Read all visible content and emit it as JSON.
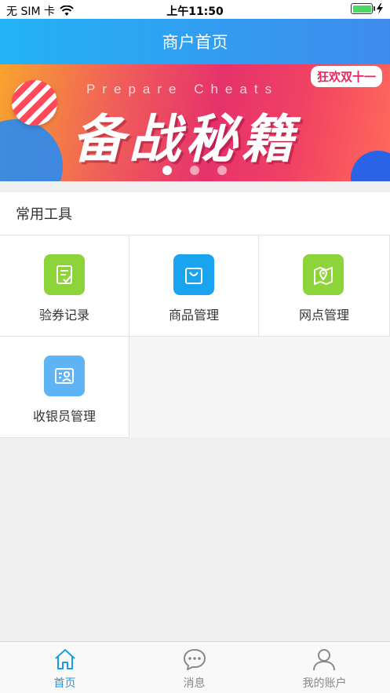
{
  "status_bar": {
    "carrier": "无 SIM 卡",
    "time": "上午11:50",
    "battery_level": 1.0
  },
  "nav": {
    "title": "商户首页"
  },
  "banner": {
    "subtitle": "Prepare Cheats",
    "title": "备战秘籍",
    "tag": "狂欢双十一",
    "dot_count": 3,
    "active_dot": 0
  },
  "tools": {
    "section_title": "常用工具",
    "items": [
      {
        "label": "验券记录",
        "icon": "coupon-record-icon",
        "color": "#8dd43a"
      },
      {
        "label": "商品管理",
        "icon": "shopping-bag-icon",
        "color": "#1aa4ef"
      },
      {
        "label": "网点管理",
        "icon": "map-location-icon",
        "color": "#8dd43a"
      },
      {
        "label": "收银员管理",
        "icon": "cashier-icon",
        "color": "#5fb4f5"
      }
    ]
  },
  "tab_bar": {
    "tabs": [
      {
        "label": "首页",
        "icon": "home-icon",
        "active": true
      },
      {
        "label": "消息",
        "icon": "message-icon",
        "active": false
      },
      {
        "label": "我的账户",
        "icon": "user-icon",
        "active": false
      }
    ]
  },
  "colors": {
    "accent": "#1a9be8",
    "nav_start": "#23b3f6",
    "nav_end": "#3f8bec"
  }
}
